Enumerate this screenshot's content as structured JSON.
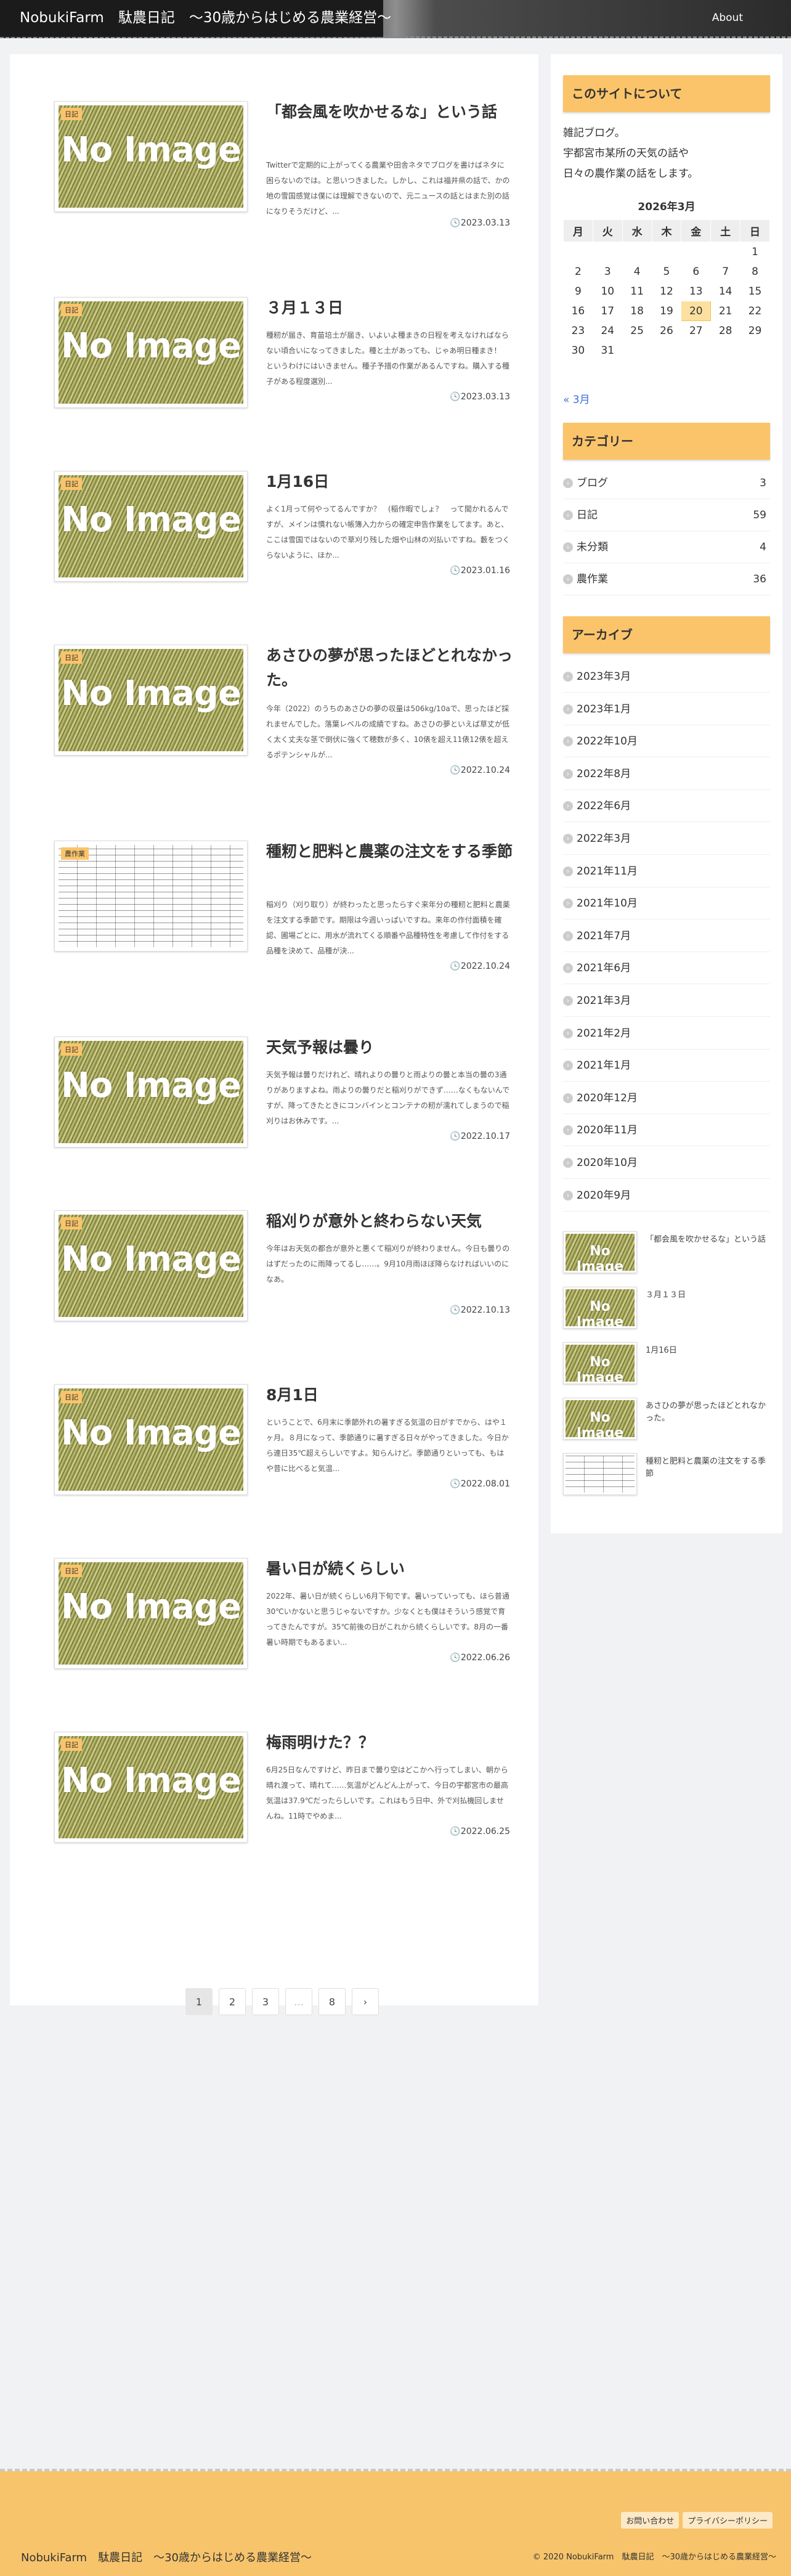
{
  "site_title": "NobukiFarm　駄農日記　〜30歳からはじめる農業経営〜",
  "nav": {
    "about": "About"
  },
  "no_image": "No Image",
  "posts": [
    {
      "category": "日記",
      "title": "「都会風を吹かせるな」という話",
      "excerpt": "Twitterで定期的に上がってくる農業や田舎ネタでブログを書けばネタに困らないのでは。と思いつきました。しかし、これは福井県の話で、かの地の雪国感覚は僕には理解できないので、元ニュースの話とはまた別の話になりそうだけど、...",
      "date": "2023.03.13"
    },
    {
      "category": "日記",
      "title": "３月１３日",
      "excerpt": "種籾が届き、育苗培土が届き、いよいよ種まきの日程を考えなければならない頃合いになってきました。種と土があっても、じゃあ明日種まき！　というわけにはいきません。種子予措の作業があるんですね。購入する種子がある程度選別...",
      "date": "2023.03.13"
    },
    {
      "category": "日記",
      "title": "1月16日",
      "excerpt": "よく1月って何やってるんですか？　(稲作暇でしょ？　って聞かれるんですが、メインは慣れない帳簿入力からの確定申告作業をしてます。あと、ここは雪国ではないので草刈り残した畑や山林の刈払いですね。藪をつくらないように、ほか...",
      "date": "2023.01.16"
    },
    {
      "category": "日記",
      "title": "あさひの夢が思ったほどとれなかった。",
      "excerpt": "今年（2022）のうちのあさひの夢の収量は506kg/10aで、思ったほど採れませんでした。落葉レベルの成績ですね。あさひの夢といえば草丈が低く太く丈夫な茎で倒伏に強くて穂数が多く、10俵を超え11俵12俵を超えるポテンシャルが...",
      "date": "2022.10.24"
    },
    {
      "category": "農作業",
      "title": "種籾と肥料と農薬の注文をする季節",
      "excerpt": "稲刈り（刈り取り）が終わったと思ったらすぐ来年分の種籾と肥料と農薬を注文する季節です。期限は今週いっぱいですね。来年の作付面積を確認、圃場ごとに、用水が流れてくる順番や品種特性を考慮して作付をする品種を決めて、品種が決...",
      "date": "2022.10.24"
    },
    {
      "category": "日記",
      "title": "天気予報は曇り",
      "excerpt": "天気予報は曇りだけれど、晴れよりの曇りと雨よりの曇と本当の曇の3通りがありますよね。雨よりの曇りだと稲刈りができず……なくもないんですが、降ってきたときにコンバインとコンテナの籾が濡れてしまうので稲刈りはお休みです。...",
      "date": "2022.10.17"
    },
    {
      "category": "日記",
      "title": "稲刈りが意外と終わらない天気",
      "excerpt": "今年はお天気の都合が意外と悪くて稲刈りが終わりません。今日も曇りのはずだったのに雨降ってるし……。9月10月雨ほぼ降らなければいいのになあ。",
      "date": "2022.10.13"
    },
    {
      "category": "日記",
      "title": "8月1日",
      "excerpt": "ということで、6月末に季節外れの暑すぎる気温の日がすでから、はや１ヶ月。８月になって、季節通りに暑すぎる日々がやってきました。今日から連日35℃超えらしいですよ。知らんけど。季節通りといっても、もはや昔に比べると気温...",
      "date": "2022.08.01"
    },
    {
      "category": "日記",
      "title": "暑い日が続くらしい",
      "excerpt": "2022年、暑い日が続くらしい6月下旬です。暑いっていっても、ほら普通30℃いかないと思うじゃないですか。少なくとも僕はそういう感覚で育ってきたんですが。35℃前後の日がこれから続くらしいです。8月の一番暑い時期でもあるまい...",
      "date": "2022.06.26"
    },
    {
      "category": "日記",
      "title": "梅雨明けた？？",
      "excerpt": "6月25日なんですけど、昨日まで曇り空はどこかへ行ってしまい、朝から晴れ渡って、晴れて……気温がどんどん上がって、今日の宇都宮市の最高気温は37.9℃だったらしいです。これはもう日中、外で刈払機回しませんね。11時でやめま...",
      "date": "2022.06.25"
    }
  ],
  "pager": [
    "1",
    "2",
    "3",
    "…",
    "8",
    "›"
  ],
  "sidebar": {
    "about_heading": "このサイトについて",
    "about_lines": [
      "雑記ブログ。",
      "宇都宮市某所の天気の話や",
      "日々の農作業の話をします。"
    ],
    "calendar": {
      "caption": "2026年3月",
      "weekdays": [
        "月",
        "火",
        "水",
        "木",
        "金",
        "土",
        "日"
      ],
      "rows": [
        [
          "",
          "",
          "",
          "",
          "",
          "",
          "1"
        ],
        [
          "2",
          "3",
          "4",
          "5",
          "6",
          "7",
          "8"
        ],
        [
          "9",
          "10",
          "11",
          "12",
          "13",
          "14",
          "15"
        ],
        [
          "16",
          "17",
          "18",
          "19",
          "20",
          "21",
          "22"
        ],
        [
          "23",
          "24",
          "25",
          "26",
          "27",
          "28",
          "29"
        ],
        [
          "30",
          "31",
          "",
          "",
          "",
          "",
          ""
        ]
      ],
      "today": "20",
      "prev": "« 3月"
    },
    "categories_heading": "カテゴリー",
    "categories": [
      {
        "name": "ブログ",
        "count": "3"
      },
      {
        "name": "日記",
        "count": "59"
      },
      {
        "name": "未分類",
        "count": "4"
      },
      {
        "name": "農作業",
        "count": "36"
      }
    ],
    "archive_heading": "アーカイブ",
    "archives": [
      "2023年3月",
      "2023年1月",
      "2022年10月",
      "2022年8月",
      "2022年6月",
      "2022年3月",
      "2021年11月",
      "2021年10月",
      "2021年7月",
      "2021年6月",
      "2021年3月",
      "2021年2月",
      "2021年1月",
      "2020年12月",
      "2020年11月",
      "2020年10月",
      "2020年9月"
    ],
    "popular": [
      "「都会風を吹かせるな」という話",
      "３月１３日",
      "1月16日",
      "あさひの夢が思ったほどとれなかった。",
      "種籾と肥料と農薬の注文をする季節"
    ]
  },
  "footer": {
    "links": [
      "お問い合わせ",
      "プライバシーポリシー"
    ],
    "site_title": "NobukiFarm　駄農日記　〜30歳からはじめる農業経営〜",
    "copyright": "© 2020 NobukiFarm　駄農日記　〜30歳からはじめる農業経営〜"
  },
  "colors": {
    "accent": "#fbc46a",
    "link": "#3a6fd8",
    "footer_bg": "#f7c46b"
  }
}
